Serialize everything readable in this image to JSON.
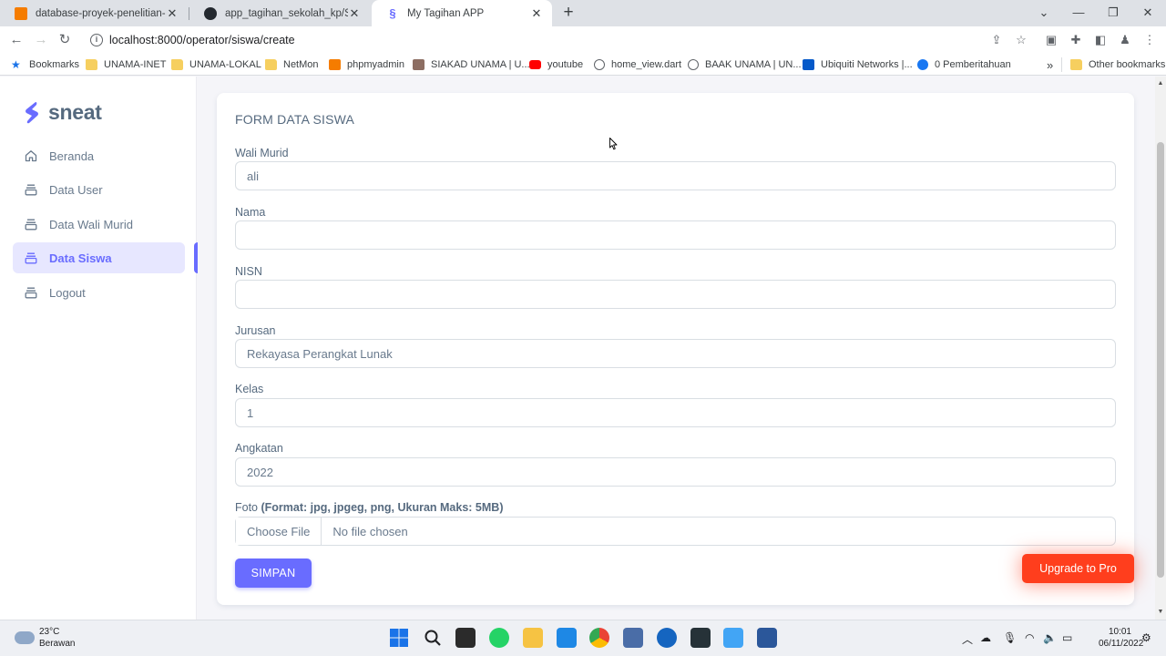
{
  "browser": {
    "tabs": [
      {
        "title": "database-proyek-penelitian-mah",
        "active": false
      },
      {
        "title": "app_tagihan_sekolah_kp/SiswaCo",
        "active": false
      },
      {
        "title": "My Tagihan APP",
        "active": true
      }
    ],
    "url": "localhost:8000/operator/siswa/create",
    "bookmarks": [
      {
        "label": "Bookmarks",
        "icon": "star-icon"
      },
      {
        "label": "UNAMA-INET",
        "icon": "folder-icon"
      },
      {
        "label": "UNAMA-LOKAL",
        "icon": "folder-icon"
      },
      {
        "label": "NetMon",
        "icon": "folder-icon"
      },
      {
        "label": "phpmyadmin",
        "icon": "phpmyadmin-icon"
      },
      {
        "label": "SIAKAD UNAMA | U...",
        "icon": "siakad-icon"
      },
      {
        "label": "youtube",
        "icon": "youtube-icon"
      },
      {
        "label": "home_view.dart",
        "icon": "globe-icon"
      },
      {
        "label": "BAAK UNAMA | UN...",
        "icon": "globe-icon"
      },
      {
        "label": "Ubiquiti Networks |...",
        "icon": "ubiquiti-icon"
      },
      {
        "label": "0 Pemberitahuan",
        "icon": "facebook-icon"
      }
    ],
    "more_bookmarks": "»",
    "other_bookmarks": "Other bookmarks"
  },
  "sidebar": {
    "brand": "sneat",
    "items": [
      {
        "label": "Beranda",
        "icon": "home-icon",
        "active": false
      },
      {
        "label": "Data User",
        "icon": "layers-icon",
        "active": false
      },
      {
        "label": "Data Wali Murid",
        "icon": "layers-icon",
        "active": false
      },
      {
        "label": "Data Siswa",
        "icon": "layers-icon",
        "active": true
      },
      {
        "label": "Logout",
        "icon": "layers-icon",
        "active": false
      }
    ]
  },
  "form": {
    "title": "FORM DATA SISWA",
    "fields": [
      {
        "label": "Wali Murid",
        "value": "ali"
      },
      {
        "label": "Nama",
        "value": ""
      },
      {
        "label": "NISN",
        "value": ""
      },
      {
        "label": "Jurusan",
        "value": "Rekayasa Perangkat Lunak"
      },
      {
        "label": "Kelas",
        "value": "1"
      },
      {
        "label": "Angkatan",
        "value": "2022"
      }
    ],
    "foto": {
      "label": "Foto",
      "hint": "(Format: jpg, jpgeg, png, Ukuran Maks: 5MB)",
      "choose": "Choose File",
      "status": "No file chosen"
    },
    "submit": "SIMPAN"
  },
  "upgrade": "Upgrade to Pro",
  "taskbar": {
    "temperature": "23°C",
    "weather": "Berawan",
    "time": "10:01",
    "date": "06/11/2022"
  },
  "colors": {
    "primary": "#696cff",
    "upgrade": "#ff3e1d",
    "page_bg": "#f5f5f9"
  }
}
